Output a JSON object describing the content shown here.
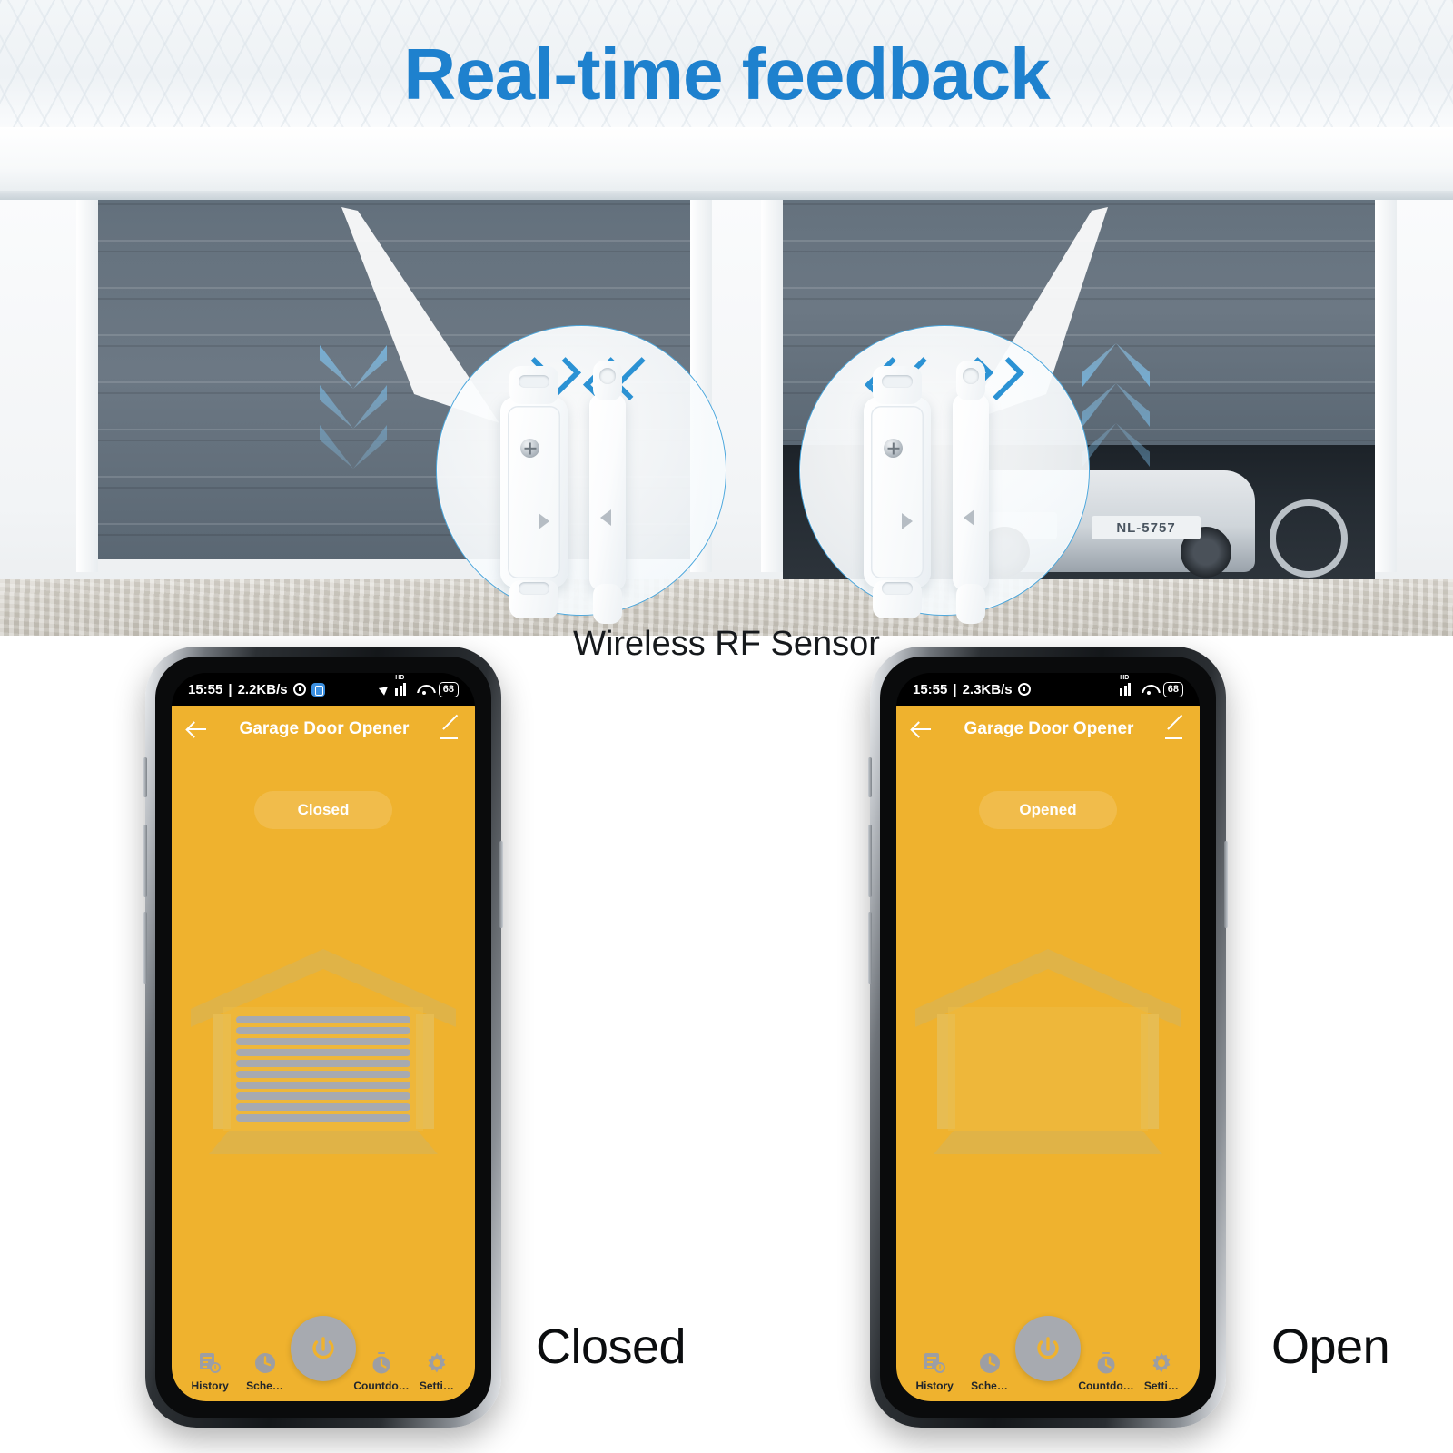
{
  "headline": "Real-time feedback",
  "scene": {
    "sensor_caption": "Wireless RF Sensor",
    "callouts": [
      {
        "id": "left",
        "direction_hint": "closing",
        "chevrons": [
          "»",
          "«"
        ],
        "door_arrows": "down",
        "icon": "door-sensor-icon"
      },
      {
        "id": "right",
        "direction_hint": "opening",
        "chevrons": [
          "«",
          "»"
        ],
        "door_arrows": "up",
        "icon": "door-sensor-icon"
      }
    ],
    "car_plate": "NL-5757"
  },
  "phones": [
    {
      "id": "closed",
      "state_label": "Closed",
      "statusbar": {
        "time": "15:55",
        "separator": "|",
        "net_speed": "2.2KB/s",
        "alarm_icon": "alarm-clock-icon",
        "app_icon": "blue-app-icon",
        "location_icon": "location-arrow-icon",
        "hd_label": "HD",
        "signal_icon": "cellular-signal-icon",
        "wifi_icon": "wifi-icon",
        "battery": "68"
      },
      "appbar": {
        "back_icon": "back-arrow-icon",
        "title": "Garage Door Opener",
        "edit_icon": "pencil-edit-icon"
      },
      "status_pill": "Closed",
      "garage_state": "closed",
      "bottomnav": {
        "items": [
          {
            "label": "History",
            "icon": "history-icon"
          },
          {
            "label": "Sche…",
            "icon": "clock-schedule-icon"
          },
          {
            "label": "Countdo…",
            "icon": "countdown-timer-icon"
          },
          {
            "label": "Setti…",
            "icon": "gear-settings-icon"
          }
        ],
        "power_icon": "power-button-icon"
      }
    },
    {
      "id": "open",
      "state_label": "Open",
      "statusbar": {
        "time": "15:55",
        "separator": "|",
        "net_speed": "2.3KB/s",
        "alarm_icon": "alarm-clock-icon",
        "app_icon": "",
        "location_icon": "",
        "hd_label": "HD",
        "signal_icon": "cellular-signal-icon",
        "wifi_icon": "wifi-icon",
        "battery": "68"
      },
      "appbar": {
        "back_icon": "back-arrow-icon",
        "title": "Garage Door Opener",
        "edit_icon": "pencil-edit-icon"
      },
      "status_pill": "Opened",
      "garage_state": "opened",
      "bottomnav": {
        "items": [
          {
            "label": "History",
            "icon": "history-icon"
          },
          {
            "label": "Sche…",
            "icon": "clock-schedule-icon"
          },
          {
            "label": "Countdo…",
            "icon": "countdown-timer-icon"
          },
          {
            "label": "Setti…",
            "icon": "gear-settings-icon"
          }
        ],
        "power_icon": "power-button-icon"
      }
    }
  ],
  "colors": {
    "headline_blue": "#1e81ce",
    "app_yellow": "#efb22e",
    "chevron_blue": "#2b92d4",
    "callout_ring": "#4ea8dd",
    "nav_grey": "#a7aab0",
    "door_grey": "#667380"
  }
}
